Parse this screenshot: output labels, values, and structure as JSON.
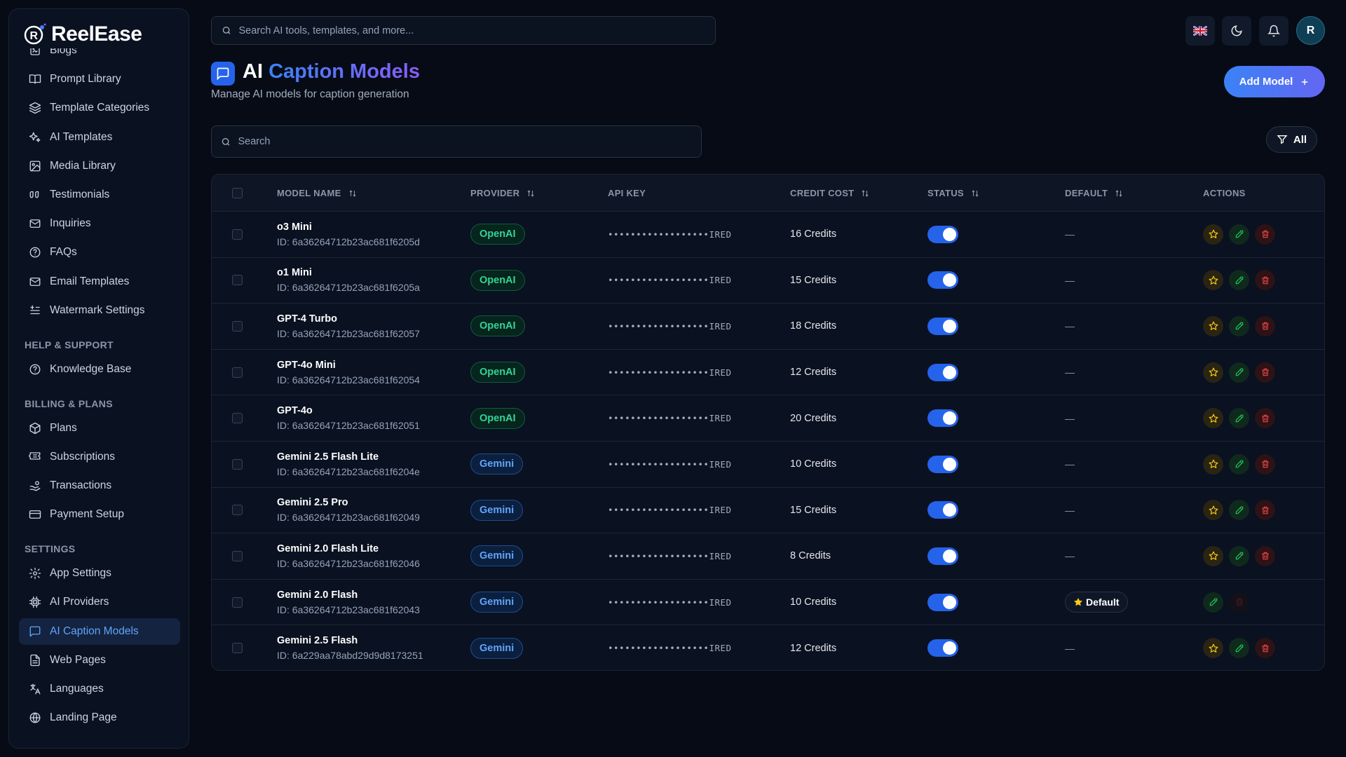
{
  "app": {
    "name": "ReelEase"
  },
  "sidebar": {
    "items_top": [
      {
        "label": "Blogs",
        "icon": "blog-icon"
      },
      {
        "label": "Prompt Library",
        "icon": "book-open-icon"
      },
      {
        "label": "Template Categories",
        "icon": "layers-icon"
      },
      {
        "label": "AI Templates",
        "icon": "sparkles-icon"
      },
      {
        "label": "Media Library",
        "icon": "image-icon"
      },
      {
        "label": "Testimonials",
        "icon": "quote-icon"
      },
      {
        "label": "Inquiries",
        "icon": "mail-icon"
      },
      {
        "label": "FAQs",
        "icon": "help-circle-icon"
      },
      {
        "label": "Email Templates",
        "icon": "mail-icon"
      },
      {
        "label": "Watermark Settings",
        "icon": "watermark-icon"
      }
    ],
    "section_help": "HELP & SUPPORT",
    "items_help": [
      {
        "label": "Knowledge Base",
        "icon": "help-circle-icon"
      }
    ],
    "section_billing": "BILLING & PLANS",
    "items_billing": [
      {
        "label": "Plans",
        "icon": "package-icon"
      },
      {
        "label": "Subscriptions",
        "icon": "ticket-icon"
      },
      {
        "label": "Transactions",
        "icon": "hand-coins-icon"
      },
      {
        "label": "Payment Setup",
        "icon": "credit-card-icon"
      }
    ],
    "section_settings": "SETTINGS",
    "items_settings": [
      {
        "label": "App Settings",
        "icon": "gear-icon"
      },
      {
        "label": "AI Providers",
        "icon": "cpu-icon"
      },
      {
        "label": "AI Caption Models",
        "icon": "message-square-icon",
        "active": true
      },
      {
        "label": "Web Pages",
        "icon": "file-text-icon"
      },
      {
        "label": "Languages",
        "icon": "languages-icon"
      },
      {
        "label": "Landing Page",
        "icon": "globe-icon"
      }
    ]
  },
  "topbar": {
    "search_placeholder": "Search AI tools, templates, and more...",
    "avatar_initial": "R"
  },
  "page": {
    "title_plain": "AI",
    "title_accent": "Caption Models",
    "subtitle": "Manage AI models for caption generation",
    "add_button": "Add Model",
    "search_placeholder": "Search",
    "filter_label": "All"
  },
  "table": {
    "headers": {
      "model_name": "MODEL NAME",
      "provider": "PROVIDER",
      "api_key": "API KEY",
      "credit_cost": "CREDIT COST",
      "status": "STATUS",
      "default": "DEFAULT",
      "actions": "ACTIONS"
    },
    "rows": [
      {
        "name": "o3 Mini",
        "id": "ID: 6a36264712b23ac681f6205d",
        "provider": "OpenAI",
        "api_key": "••••••••••••••••••IRED",
        "credits": "16 Credits",
        "status": true,
        "default": "—"
      },
      {
        "name": "o1 Mini",
        "id": "ID: 6a36264712b23ac681f6205a",
        "provider": "OpenAI",
        "api_key": "••••••••••••••••••IRED",
        "credits": "15 Credits",
        "status": true,
        "default": "—"
      },
      {
        "name": "GPT-4 Turbo",
        "id": "ID: 6a36264712b23ac681f62057",
        "provider": "OpenAI",
        "api_key": "••••••••••••••••••IRED",
        "credits": "18 Credits",
        "status": true,
        "default": "—"
      },
      {
        "name": "GPT-4o Mini",
        "id": "ID: 6a36264712b23ac681f62054",
        "provider": "OpenAI",
        "api_key": "••••••••••••••••••IRED",
        "credits": "12 Credits",
        "status": true,
        "default": "—"
      },
      {
        "name": "GPT-4o",
        "id": "ID: 6a36264712b23ac681f62051",
        "provider": "OpenAI",
        "api_key": "••••••••••••••••••IRED",
        "credits": "20 Credits",
        "status": true,
        "default": "—"
      },
      {
        "name": "Gemini 2.5 Flash Lite",
        "id": "ID: 6a36264712b23ac681f6204e",
        "provider": "Gemini",
        "api_key": "••••••••••••••••••IRED",
        "credits": "10 Credits",
        "status": true,
        "default": "—"
      },
      {
        "name": "Gemini 2.5 Pro",
        "id": "ID: 6a36264712b23ac681f62049",
        "provider": "Gemini",
        "api_key": "••••••••••••••••••IRED",
        "credits": "15 Credits",
        "status": true,
        "default": "—"
      },
      {
        "name": "Gemini 2.0 Flash Lite",
        "id": "ID: 6a36264712b23ac681f62046",
        "provider": "Gemini",
        "api_key": "••••••••••••••••••IRED",
        "credits": "8 Credits",
        "status": true,
        "default": "—"
      },
      {
        "name": "Gemini 2.0 Flash",
        "id": "ID: 6a36264712b23ac681f62043",
        "provider": "Gemini",
        "api_key": "••••••••••••••••••IRED",
        "credits": "10 Credits",
        "status": true,
        "default": "Default",
        "is_default": true
      },
      {
        "name": "Gemini 2.5 Flash",
        "id": "ID: 6a229aa78abd29d9d8173251",
        "provider": "Gemini",
        "api_key": "••••••••••••••••••IRED",
        "credits": "12 Credits",
        "status": true,
        "default": "—"
      }
    ]
  },
  "colors": {
    "accent": "#3b82f6",
    "openai": "#34d399",
    "gemini": "#60a5fa",
    "star": "#facc15",
    "edit": "#22c55e",
    "delete": "#ef4444"
  }
}
